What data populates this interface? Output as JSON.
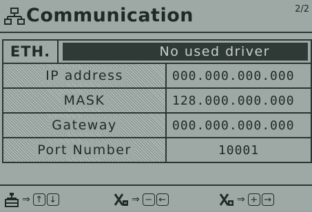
{
  "header": {
    "title": "Communication",
    "page": "2/2"
  },
  "eth": {
    "label": "ETH.",
    "value": "No used driver"
  },
  "rows": [
    {
      "label": "IP address",
      "value": "000.000.000.000"
    },
    {
      "label": "MASK",
      "value": "128.000.000.000"
    },
    {
      "label": "Gateway",
      "value": "000.000.000.000"
    },
    {
      "label": "Port Number",
      "value": "10001"
    }
  ],
  "footer": {
    "arrow": "⇒",
    "nav_keys": [
      "↑",
      "↓"
    ],
    "dec_keys": [
      "−",
      "←"
    ],
    "inc_keys": [
      "+",
      "→"
    ]
  }
}
